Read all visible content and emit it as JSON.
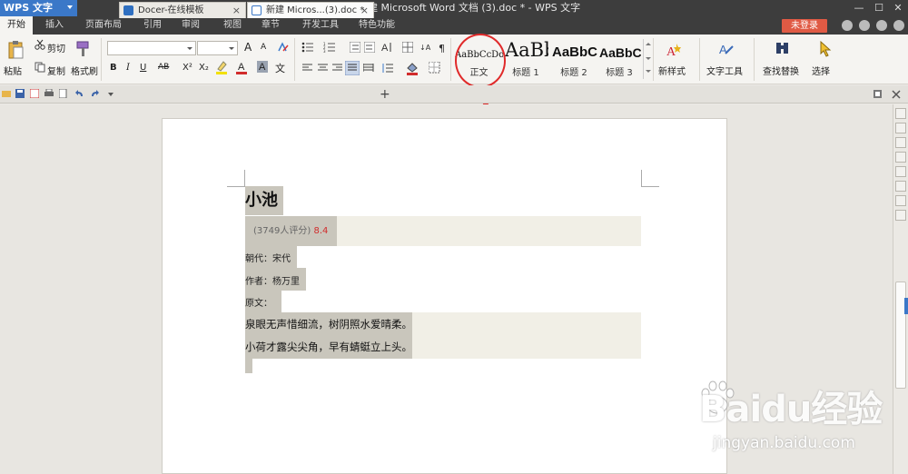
{
  "app": {
    "name": "WPS 文字",
    "window_title": "新建 Microsoft Word 文档 (3).doc * - WPS 文字"
  },
  "menus": [
    "开始",
    "插入",
    "页面布局",
    "引用",
    "审阅",
    "视图",
    "章节",
    "开发工具",
    "特色功能"
  ],
  "login_label": "未登录",
  "ribbon": {
    "paste": "粘贴",
    "cut": "剪切",
    "copy": "复制",
    "format_painter": "格式刷",
    "font_name": "",
    "font_size": "",
    "styles": [
      {
        "sample": "AaBbCcDd",
        "label": "正文"
      },
      {
        "sample": "AaBb",
        "label": "标题 1"
      },
      {
        "sample": "AaBbC",
        "label": "标题 2"
      },
      {
        "sample": "AaBbC",
        "label": "标题 3"
      }
    ],
    "new_style": "新样式",
    "text_tools": "文字工具",
    "find_replace": "查找替换",
    "select": "选择",
    "bold": "B",
    "italic": "I",
    "underline": "U",
    "ab": "AB",
    "superscript": "X²",
    "subscript": "X₂",
    "font_grow": "A",
    "font_shrink": "A"
  },
  "tabs": [
    {
      "label": "Docer-在线模板",
      "close": "×"
    },
    {
      "label": "新建 Micros...(3).doc *",
      "close": "×"
    }
  ],
  "doc": {
    "title": "小池",
    "rating": "(3749人评分)",
    "score": "8.4",
    "dynasty": "朝代：宋代",
    "author": "作者：杨万里",
    "original": "原文：",
    "poem_line1": "泉眼无声惜细流，树阴照水爱晴柔。",
    "poem_line2": "小荷才露尖尖角，早有蜻蜓立上头。"
  },
  "watermark": {
    "brand": "Baidu经验",
    "sub": "jingyan.baidu.com"
  },
  "colors": {
    "accent": "#3b78c8",
    "login": "#e05a44",
    "annotation": "#e02a2a",
    "score": "#d12c2c"
  }
}
